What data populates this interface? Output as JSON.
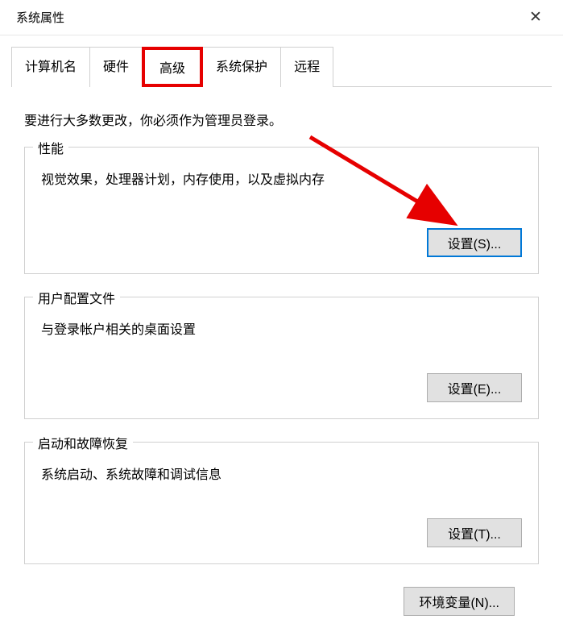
{
  "window": {
    "title": "系统属性",
    "close_label": "✕"
  },
  "tabs": [
    {
      "label": "计算机名"
    },
    {
      "label": "硬件"
    },
    {
      "label": "高级"
    },
    {
      "label": "系统保护"
    },
    {
      "label": "远程"
    }
  ],
  "intro": "要进行大多数更改，你必须作为管理员登录。",
  "groups": {
    "performance": {
      "legend": "性能",
      "desc": "视觉效果，处理器计划，内存使用，以及虚拟内存",
      "button": "设置(S)..."
    },
    "userprofile": {
      "legend": "用户配置文件",
      "desc": "与登录帐户相关的桌面设置",
      "button": "设置(E)..."
    },
    "startup": {
      "legend": "启动和故障恢复",
      "desc": "系统启动、系统故障和调试信息",
      "button": "设置(T)..."
    }
  },
  "env_button": "环境变量(N)..."
}
